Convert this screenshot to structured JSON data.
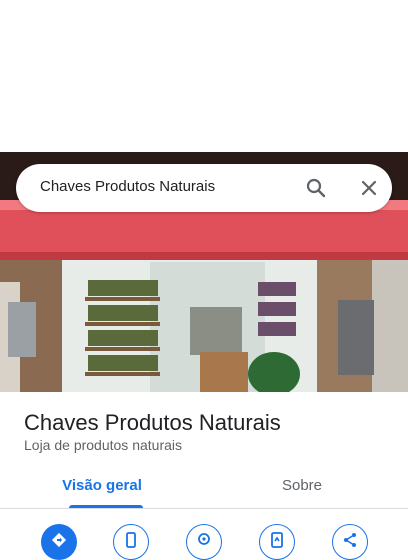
{
  "search": {
    "query": "Chaves Produtos Naturais",
    "search_icon": "search-icon",
    "close_icon": "close-icon"
  },
  "place": {
    "name": "Chaves Produtos Naturais",
    "category": "Loja de produtos naturais"
  },
  "tabs": [
    {
      "label": "Visão geral",
      "selected": true
    },
    {
      "label": "Sobre",
      "selected": false
    }
  ],
  "actions": [
    {
      "icon": "directions-icon"
    },
    {
      "icon": "phone-icon"
    },
    {
      "icon": "save-place-icon"
    },
    {
      "icon": "send-to-phone-icon"
    },
    {
      "icon": "share-icon"
    }
  ],
  "colors": {
    "accent": "#1a73e8",
    "awning": "#e0505a"
  }
}
